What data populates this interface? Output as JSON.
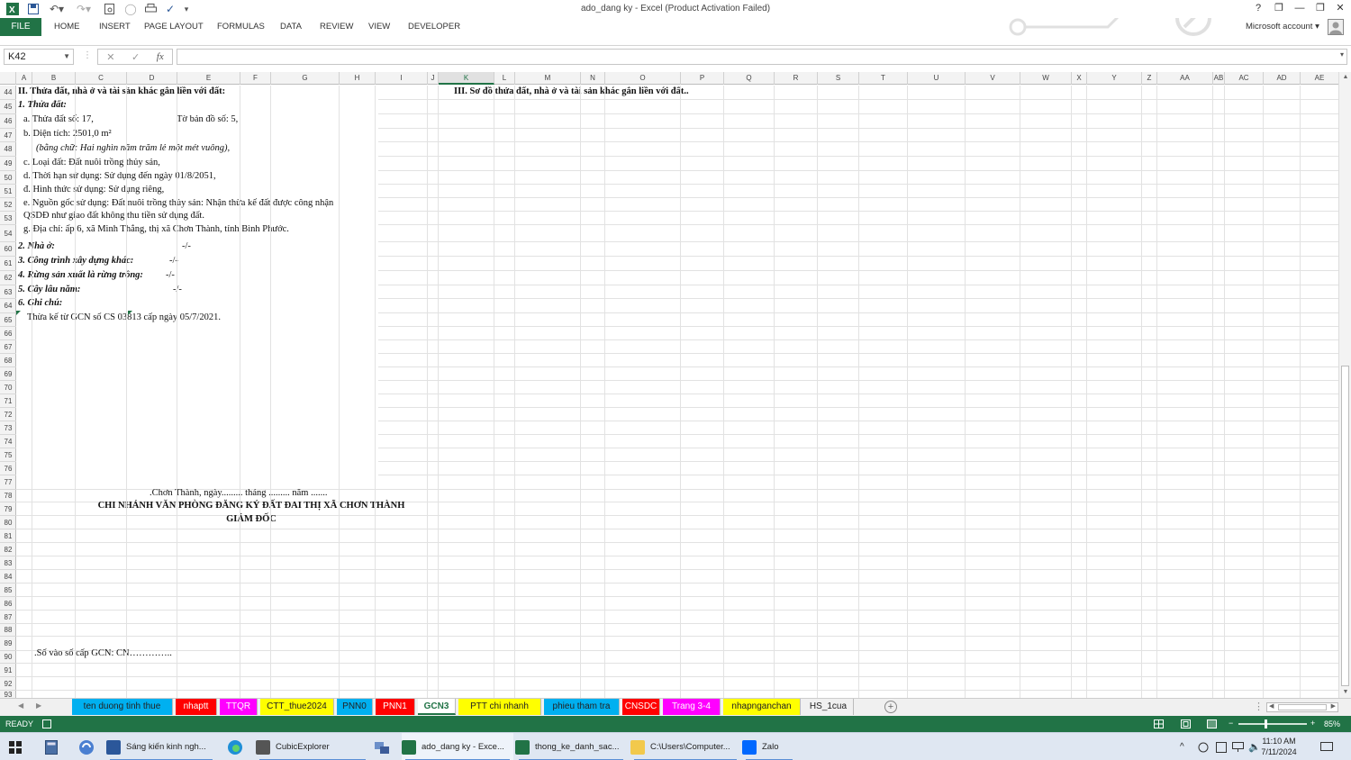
{
  "window": {
    "title": "ado_dang ky - Excel (Product Activation Failed)",
    "help": "?",
    "minimize": "—",
    "restore": "❐",
    "close": "✕"
  },
  "ribbon": {
    "file": "FILE",
    "tabs": [
      "HOME",
      "INSERT",
      "PAGE LAYOUT",
      "FORMULAS",
      "DATA",
      "REVIEW",
      "VIEW",
      "DEVELOPER"
    ],
    "account": "Microsoft account"
  },
  "formula_bar": {
    "name_box": "K42",
    "cancel": "✕",
    "enter": "✓",
    "fx": "fx",
    "value": ""
  },
  "columns": [
    "A",
    "B",
    "C",
    "D",
    "E",
    "F",
    "G",
    "H",
    "I",
    "J",
    "K",
    "L",
    "M",
    "N",
    "O",
    "P",
    "Q",
    "R",
    "S",
    "T",
    "U",
    "V",
    "W",
    "X",
    "Y",
    "Z",
    "AA",
    "AB",
    "AC",
    "AD",
    "AE"
  ],
  "selected_column": "K",
  "rows": [
    "44",
    "45",
    "46",
    "47",
    "48",
    "49",
    "50",
    "51",
    "52",
    "53",
    "54",
    "60",
    "61",
    "62",
    "63",
    "64",
    "65",
    "66",
    "67",
    "68",
    "69",
    "70",
    "71",
    "72",
    "73",
    "74",
    "75",
    "76",
    "77",
    "78",
    "79",
    "80",
    "81",
    "82",
    "83",
    "84",
    "85",
    "86",
    "87",
    "88",
    "89",
    "90",
    "91",
    "92",
    "93"
  ],
  "sheet": {
    "r44": "II. Thửa đất, nhà ở và tài sản khác gắn liền với đất:",
    "r44_k": "III. Sơ đồ thửa đất, nhà ở và tài sản khác gắn liền với đất..",
    "r45": "1. Thửa đất:",
    "r46_a": "a. Thửa đất số: 17,",
    "r46_b": "Tờ bản đồ số: 5,",
    "r47": "b. Diện tích: 2501,0 m²",
    "r48": "(bằng chữ: Hai nghìn năm trăm lẻ một mét vuông),",
    "r49": "c. Loại đất: Đất nuôi trồng thủy sản,",
    "r50": "d. Thời hạn sử dụng: Sử dụng đến ngày 01/8/2051,",
    "r51": "đ. Hình thức sử dụng: Sử dụng riêng,",
    "r52": "e. Nguồn gốc sử dụng: Đất nuôi trồng thủy sản: Nhận thừa kế đất được công nhận",
    "r53": "QSDĐ như giao đất không thu tiền sử dụng đất.",
    "r54": "g. Địa chỉ: ấp 6, xã Minh Thắng, thị xã Chơn Thành, tỉnh Bình Phước.",
    "r60": "2. Nhà ở:",
    "r60_v": "-/-",
    "r61": "3. Công trình xây dựng khác:",
    "r61_v": "-/-",
    "r62": "4. Rừng sản xuất là rừng trồng:",
    "r62_v": "-/-",
    "r63": "5. Cây lâu năm:",
    "r63_v": "-/-",
    "r64": "6. Ghi chú:",
    "r65": "Thừa kế từ GCN số CS 03813 cấp ngày 05/7/2021.",
    "r78": ".Chơn Thành, ngày......... tháng ......... năm .......",
    "r79": "CHI NHÁNH VĂN PHÒNG ĐĂNG KÝ ĐẤT ĐAI THỊ XÃ CHƠN THÀNH",
    "r80": "GIÁM ĐỐC",
    "r90": ".Số vào số cấp GCN: CN………….."
  },
  "sheet_tabs": [
    {
      "label": "ten duong tinh thue",
      "color": "#00b0f0"
    },
    {
      "label": "nhaptt",
      "color": "#ff0000"
    },
    {
      "label": "TTQR",
      "color": "#ff00ff"
    },
    {
      "label": "CTT_thue2024",
      "color": "#ffff00"
    },
    {
      "label": "PNN0",
      "color": "#00b0f0"
    },
    {
      "label": "PNN1",
      "color": "#ff0000"
    },
    {
      "label": "GCN3",
      "color": "#ffffff"
    },
    {
      "label": "PTT chi nhanh",
      "color": "#ffff00"
    },
    {
      "label": "phieu tham tra",
      "color": "#00b0f0"
    },
    {
      "label": "CNSDC",
      "color": "#ff0000"
    },
    {
      "label": "Trang 3-4",
      "color": "#ff00ff"
    },
    {
      "label": "nhapnganchan",
      "color": "#ffff00"
    },
    {
      "label": "HS_1cua",
      "color": "#f0f0f0"
    }
  ],
  "add_sheet": "+",
  "status": {
    "ready": "READY",
    "zoom": "85%",
    "zoom_minus": "−",
    "zoom_plus": "+"
  },
  "taskbar": {
    "items": [
      {
        "label": "Sáng kiến kinh ngh...",
        "icon": "word-icon",
        "color": "#2b579a"
      },
      {
        "label": "CubicExplorer",
        "icon": "explorer-icon",
        "color": "#555555"
      },
      {
        "label": "ado_dang ky - Exce...",
        "icon": "excel-icon",
        "color": "#217346"
      },
      {
        "label": "thong_ke_danh_sac...",
        "icon": "excel-icon",
        "color": "#217346"
      },
      {
        "label": "C:\\Users\\Computer...",
        "icon": "folder-icon",
        "color": "#f2c94c"
      },
      {
        "label": "Zalo",
        "icon": "zalo-icon",
        "color": "#0068ff"
      }
    ],
    "time": "11:10 AM",
    "date": "7/11/2024"
  },
  "colors": {
    "excel_green": "#217346"
  }
}
